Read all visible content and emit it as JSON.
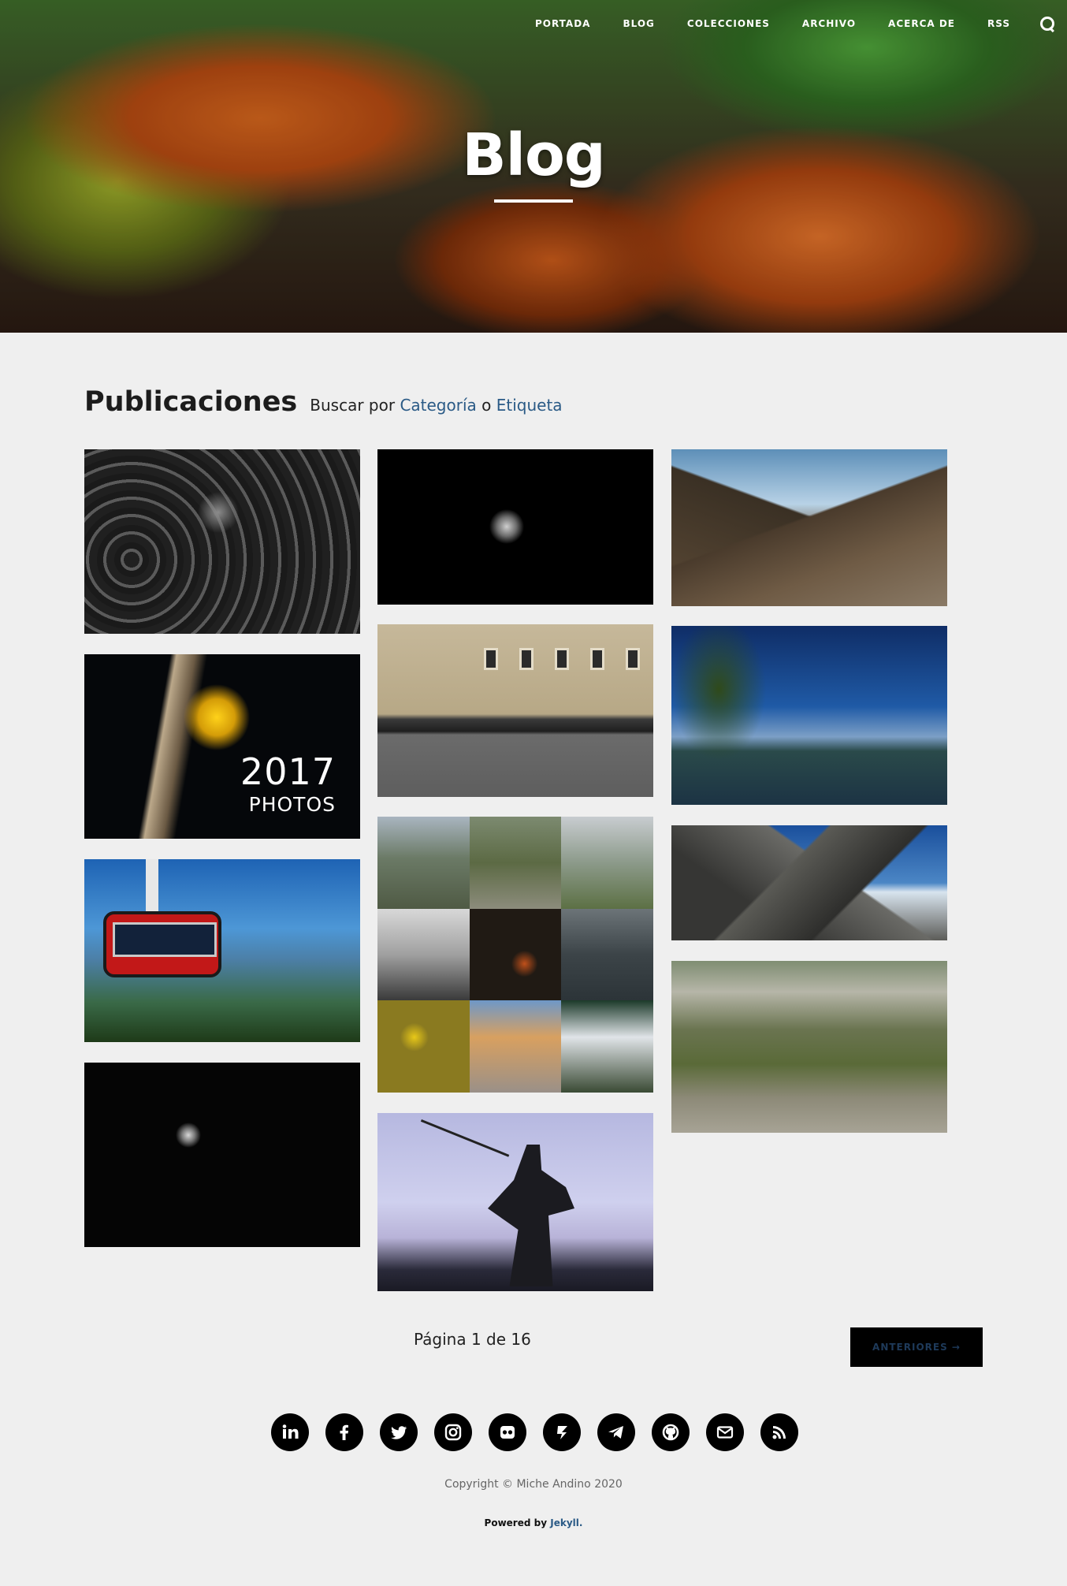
{
  "nav": {
    "items": [
      {
        "label": "PORTADA"
      },
      {
        "label": "BLOG"
      },
      {
        "label": "COLECCIONES"
      },
      {
        "label": "ARCHIVO"
      },
      {
        "label": "ACERCA DE"
      },
      {
        "label": "RSS"
      }
    ],
    "search_icon": "search-icon"
  },
  "hero": {
    "title": "Blog"
  },
  "heading": {
    "title": "Publicaciones",
    "search_prefix": "Buscar por",
    "category_link": "Categoría",
    "or_text": "o",
    "tag_link": "Etiqueta"
  },
  "posts": {
    "year_text": "2017",
    "photos_text": "PHOTOS"
  },
  "pagination": {
    "page_text": "Página 1 de 16",
    "older_label": "ANTERIORES →"
  },
  "social": {
    "icons": [
      "linkedin-icon",
      "facebook-icon",
      "twitter-icon",
      "instagram-icon",
      "flickr-icon",
      "500px-icon",
      "telegram-icon",
      "github-icon",
      "email-icon",
      "rss-icon"
    ]
  },
  "footer": {
    "copyright": "Copyright © Miche Andino 2020",
    "powered_prefix": "Powered by",
    "powered_link": "Jekyll."
  },
  "colors": {
    "page_bg": "#efefef",
    "link": "#2a5a86",
    "button_bg": "#000000"
  }
}
